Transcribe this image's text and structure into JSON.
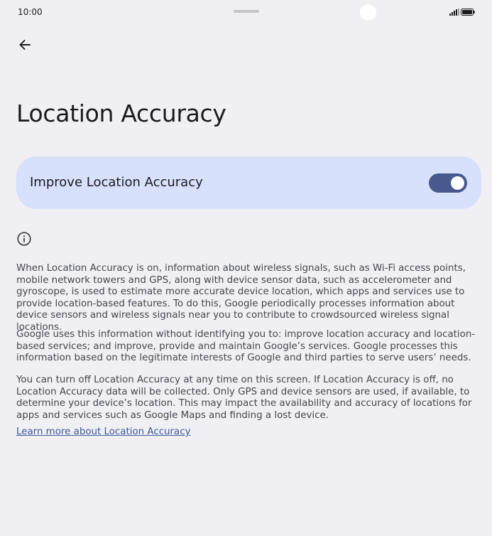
{
  "status_bar": {
    "time": "10:00",
    "icons": [
      "signal-icon",
      "battery-icon"
    ]
  },
  "header": {
    "back_icon": "arrow-back-icon",
    "title": "Location Accuracy"
  },
  "main_toggle": {
    "label": "Improve Location Accuracy",
    "state": "on"
  },
  "info_icon": "info-icon",
  "description": {
    "paragraph_1": "When Location Accuracy is on, information about wireless signals, such as Wi-Fi access points, mobile network towers and GPS, along with device sensor data, such as accelerometer and gyroscope, is used to estimate more accurate device location, which apps and services use to provide location-based features. To do this, Google periodically processes information about device sensors and wireless signals near you to contribute to crowdsourced wireless signal locations.",
    "paragraph_2": "Google uses this information without identifying you to: improve location accuracy and location-based services; and improve, provide and maintain Google’s services. Google processes this information based on the legitimate interests of Google and third parties to serve users’ needs.",
    "paragraph_3": "You can turn off Location Accuracy at any time on this screen. If Location Accuracy is off, no Location Accuracy data will be collected. Only GPS and device sensors are used, if available, to determine your device’s location. This may impact the availability and accuracy of locations for apps and services such as Google Maps and finding a lost device."
  },
  "learn_more_link": "Learn more about Location Accuracy",
  "colors": {
    "background": "#f0eff4",
    "card": "#d8e1fb",
    "switch_track": "#475a8e",
    "link": "#3d5a99"
  }
}
